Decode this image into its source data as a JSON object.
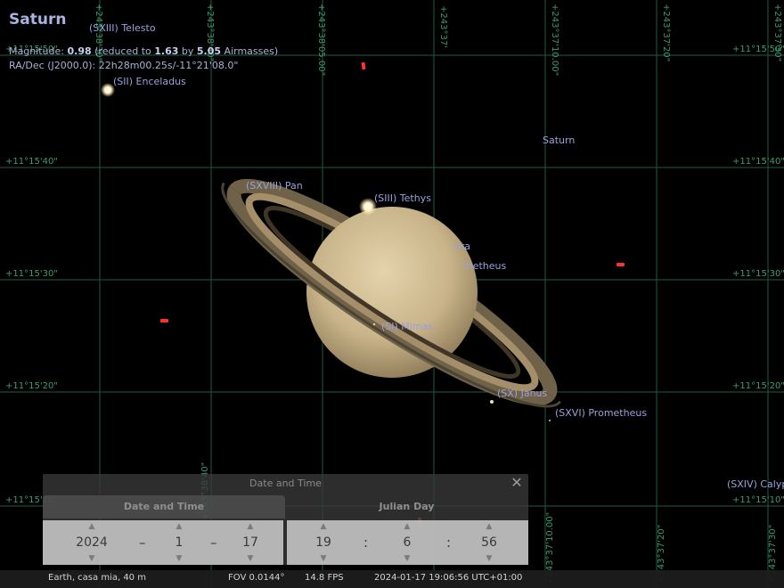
{
  "object": {
    "name": "Saturn",
    "magnitude_label": "Magnitude:",
    "magnitude": "0.98",
    "reduced_text": "(reduced to",
    "reduced_value": "1.63",
    "by_text": "by",
    "airmasses": "5.05",
    "airmasses_text": "Airmasses)",
    "radec": "RA/Dec (J2000.0): 22h28m00.25s/-11°21'08.0\""
  },
  "moons": {
    "telesto": "(SXIII) Telesto",
    "enceladus": "(SII) Enceladus",
    "saturn_label": "Saturn",
    "pan": "(SXVIII) Pan",
    "tethys": "(SIII) Tethys",
    "pandora_partial": "ora",
    "prometheus_partial": "metheus",
    "mimas": "(SI) Mimas",
    "janus": "(SX) Janus",
    "prometheus": "(SXVI) Prometheus",
    "calypso_partial": "(SXIV) Calyps"
  },
  "grid": {
    "dec_labels": [
      "+11°15'50\"",
      "+11°15'40\"",
      "+11°15'30\"",
      "+11°15'20\"",
      "+11°15'10\""
    ],
    "ra_labels": [
      "+243°38'30\"",
      "+243°38'40\"",
      "+243°38'05.00\"",
      "+243°37'",
      "+243°37'10.00\"",
      "+243°37'20\"",
      "+243°37'30\""
    ]
  },
  "dialog": {
    "title": "Date and Time",
    "tab_datetime": "Date and Time",
    "tab_julian": "Julian Day",
    "year": "2024",
    "month": "1",
    "day": "17",
    "hour": "19",
    "minute": "6",
    "second": "56",
    "date_sep": "–",
    "time_sep": ":"
  },
  "status": {
    "location": "Earth, casa mia, 40 m",
    "fov": "FOV 0.0144°",
    "fps": "14.8 FPS",
    "datetime": "2024-01-17 19:06:56 UTC+01:00"
  },
  "colors": {
    "grid": "#1c5a46",
    "label": "#9aa0dc",
    "background": "#000000"
  }
}
